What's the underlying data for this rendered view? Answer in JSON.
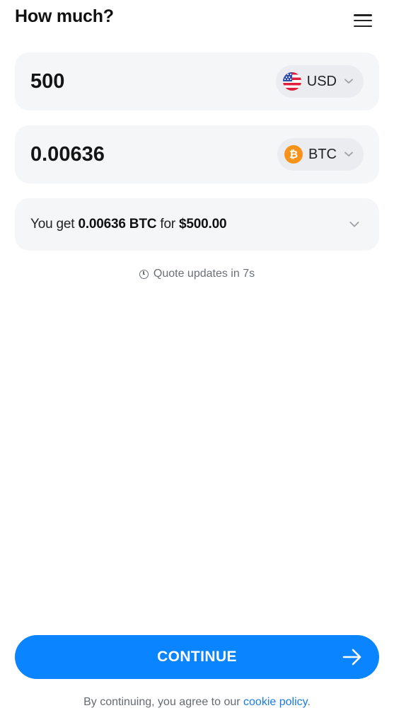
{
  "header": {
    "title": "How much?",
    "menu_icon": "hamburger-menu-icon"
  },
  "pay": {
    "amount": "500",
    "currency": "USD",
    "icon": "us-flag-icon"
  },
  "receive": {
    "amount": "0.00636",
    "currency": "BTC",
    "icon": "bitcoin-icon",
    "icon_color": "#f7931a"
  },
  "summary": {
    "prefix": "You get",
    "crypto_amount": "0.00636 BTC",
    "middle": "for",
    "fiat_amount": "$500.00"
  },
  "quote": {
    "text": "Quote updates in 7s"
  },
  "continue_button": {
    "label": "CONTINUE",
    "color": "#0a84ff"
  },
  "legal": {
    "prefix": "By continuing, you agree to our",
    "link_text": "cookie policy",
    "suffix": "."
  }
}
